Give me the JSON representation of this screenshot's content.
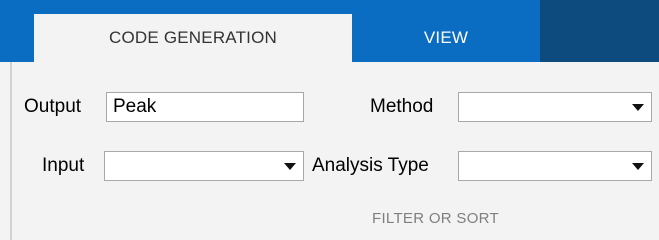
{
  "tabs": {
    "active_label": "CODE GENERATION",
    "view_label": "VIEW"
  },
  "colors": {
    "tab_bar": "#0b6dc1",
    "tab_bar_dark": "#0d4a7d",
    "panel_background": "#f3f3f3"
  },
  "fields": {
    "output_label": "Output",
    "output_value": "Peak",
    "method_label": "Method",
    "method_value": "",
    "input_label": "Input",
    "input_value": "",
    "analysis_type_label": "Analysis Type",
    "analysis_type_value": ""
  },
  "section": {
    "label": "FILTER OR SORT"
  }
}
